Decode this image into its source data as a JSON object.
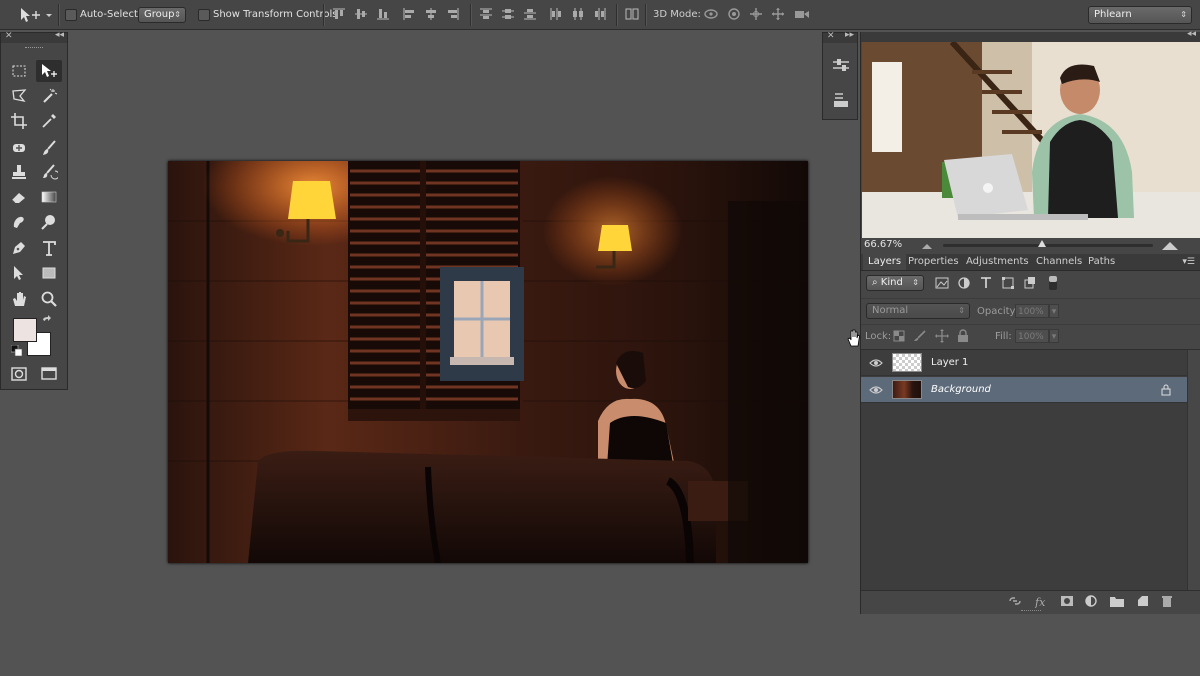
{
  "options_bar": {
    "auto_select_label": "Auto-Select:",
    "auto_select_value": "Group",
    "show_transform_label": "Show Transform Controls",
    "mode_3d_label": "3D Mode:",
    "workspace": "Phlearn"
  },
  "navigator": {
    "zoom": "66.67%",
    "zoom_slider_fraction": 0.47
  },
  "panel_tabs": [
    "Layers",
    "Properties",
    "Adjustments",
    "Channels",
    "Paths"
  ],
  "active_tab": "Layers",
  "layers_panel": {
    "filter_kind": "Kind",
    "blend_mode": "Normal",
    "opacity_label": "Opacity:",
    "opacity_value": "100%",
    "lock_label": "Lock:",
    "fill_label": "Fill:",
    "fill_value": "100%",
    "layers": [
      {
        "name": "Layer 1",
        "selected": false,
        "locked": false
      },
      {
        "name": "Background",
        "selected": true,
        "locked": true
      }
    ]
  },
  "colors": {
    "foreground": "#ede3e1",
    "background": "#ffffff",
    "selected_layer": "#5d6a7a"
  },
  "icons": {
    "tools": [
      "rectangular-marquee-icon",
      "move-icon",
      "lasso-icon",
      "magic-wand-icon",
      "crop-icon",
      "eyedropper-icon",
      "healing-brush-icon",
      "brush-icon",
      "clone-stamp-icon",
      "history-brush-icon",
      "eraser-icon",
      "gradient-icon",
      "smudge-icon",
      "dodge-icon",
      "pen-icon",
      "type-icon",
      "path-selection-icon",
      "rectangle-icon",
      "hand-icon",
      "zoom-icon"
    ],
    "layer_footer": [
      "link-icon",
      "fx-icon",
      "mask-icon",
      "adjustment-icon",
      "folder-icon",
      "new-layer-icon",
      "trash-icon"
    ]
  }
}
